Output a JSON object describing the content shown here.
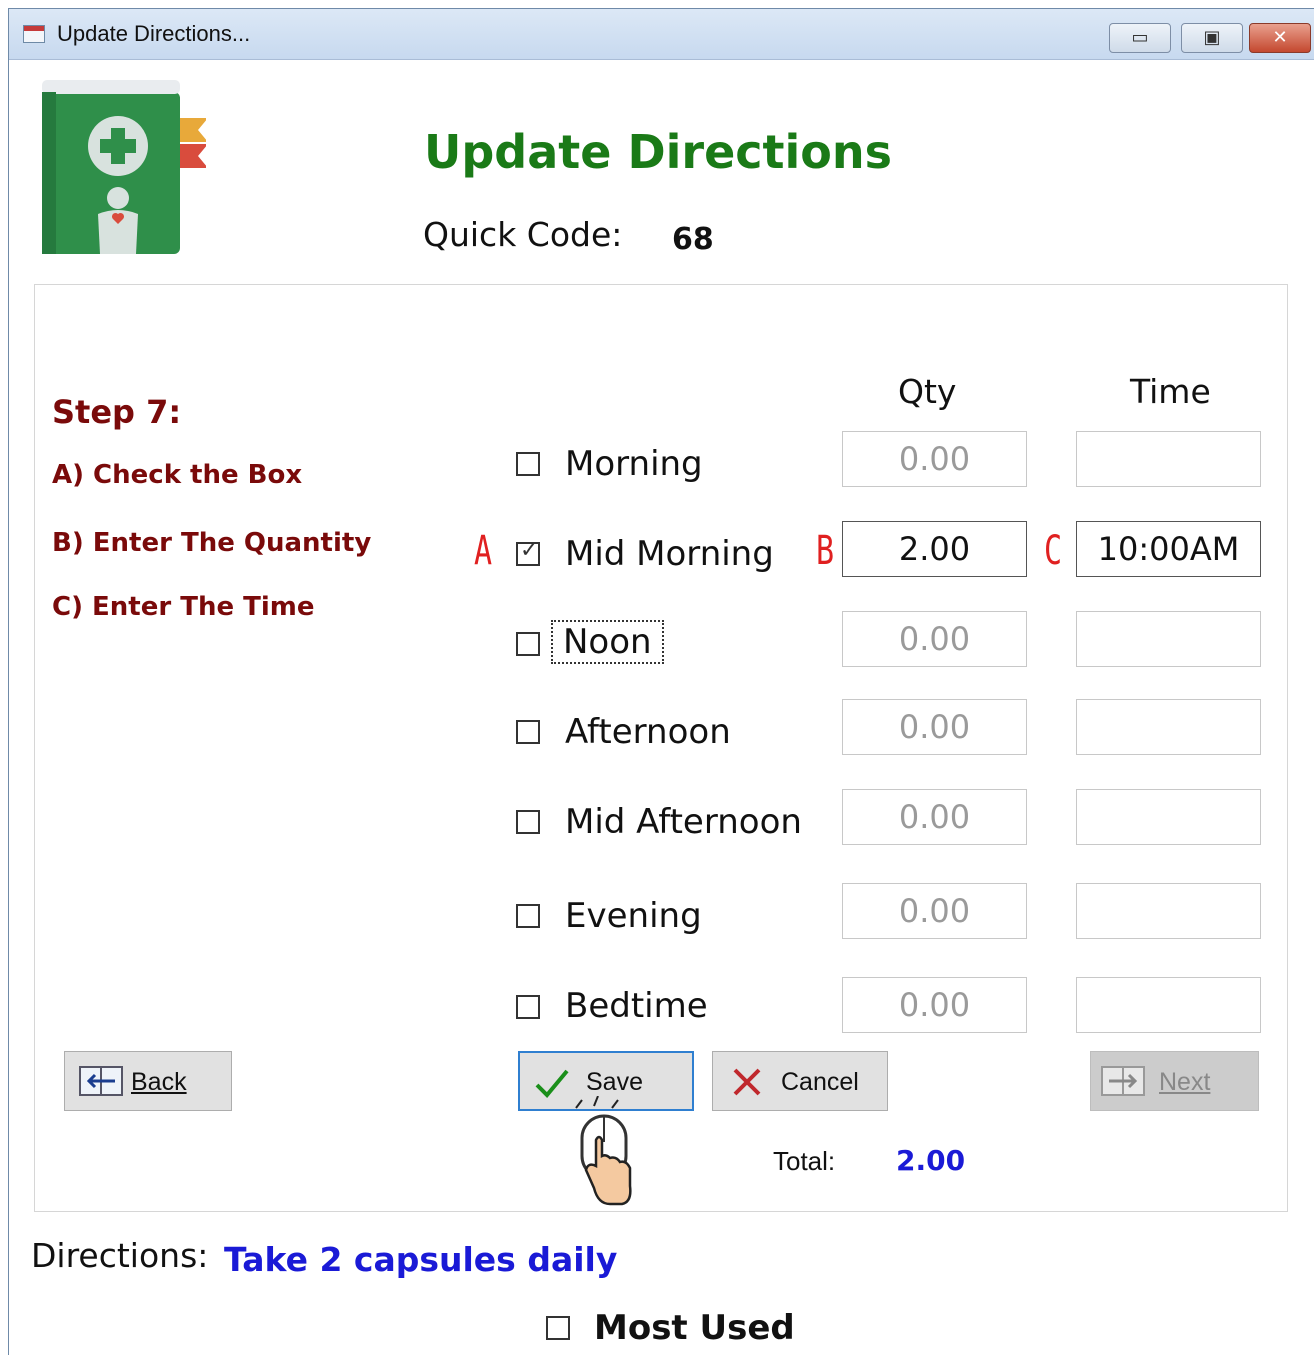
{
  "window": {
    "title": "Update Directions...",
    "controls": {
      "minimize": "▭",
      "maximize": "▣",
      "close": "✕"
    }
  },
  "header": {
    "icon": "medical-book-icon",
    "heading": "Update Directions",
    "quick_code_label": "Quick Code:",
    "quick_code_value": "68"
  },
  "instructions": {
    "step": "Step 7:",
    "a": "A) Check the Box",
    "b": "B) Enter The Quantity",
    "c": "C) Enter The Time"
  },
  "columns": {
    "qty": "Qty",
    "time": "Time"
  },
  "markers": {
    "a": "A",
    "b": "B",
    "c": "C"
  },
  "rows": [
    {
      "label": "Morning",
      "checked": false,
      "qty": "0.00",
      "time": ""
    },
    {
      "label": "Mid Morning",
      "checked": true,
      "qty": "2.00",
      "time": "10:00AM"
    },
    {
      "label": "Noon",
      "checked": false,
      "qty": "0.00",
      "time": ""
    },
    {
      "label": "Afternoon",
      "checked": false,
      "qty": "0.00",
      "time": ""
    },
    {
      "label": "Mid Afternoon",
      "checked": false,
      "qty": "0.00",
      "time": ""
    },
    {
      "label": "Evening",
      "checked": false,
      "qty": "0.00",
      "time": ""
    },
    {
      "label": "Bedtime",
      "checked": false,
      "qty": "0.00",
      "time": ""
    }
  ],
  "buttons": {
    "back": "Back",
    "save": "Save",
    "cancel": "Cancel",
    "next": "Next"
  },
  "total": {
    "label": "Total:",
    "value": "2.00"
  },
  "directions": {
    "label": "Directions:",
    "value": "Take 2 capsules daily"
  },
  "most_used": {
    "label": "Most Used",
    "checked": false
  },
  "colors": {
    "heading": "#1a7a17",
    "steps": "#7a0a0a",
    "highlight_blue": "#1a1ad6",
    "marker_red": "#e02020",
    "save_border": "#2f7fd0"
  }
}
